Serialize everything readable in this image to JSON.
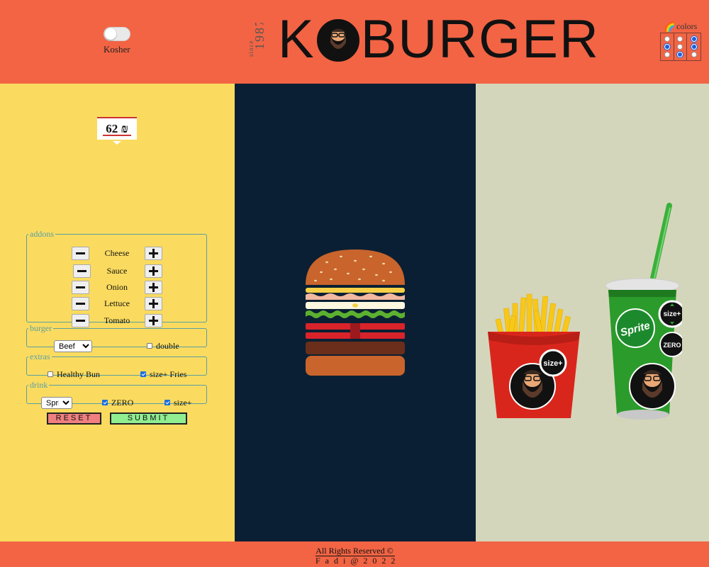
{
  "header": {
    "kosher_label": "Kosher",
    "kosher_on": false,
    "since_label": "since",
    "year": "1987",
    "brand_first": "K",
    "brand_rest": "BURGER",
    "colors_label": "colors",
    "colors_icon": "rainbow-icon",
    "colors_grid_selected": [
      [
        false,
        true,
        false
      ],
      [
        false,
        false,
        true
      ],
      [
        false,
        true,
        false
      ]
    ]
  },
  "price": {
    "value": "62 ₪"
  },
  "addons": {
    "legend": "addons",
    "items": [
      {
        "label": "Cheese"
      },
      {
        "label": "Sauce"
      },
      {
        "label": "Onion"
      },
      {
        "label": "Lettuce"
      },
      {
        "label": "Tomato"
      }
    ]
  },
  "burger": {
    "legend": "burger",
    "selected": "Beef",
    "double_label": "double",
    "double_checked": false
  },
  "extras": {
    "legend": "extras",
    "healthy_bun_label": "Healthy Bun",
    "healthy_bun_checked": false,
    "size_fries_label": "size+ Fries",
    "size_fries_checked": true
  },
  "drink": {
    "legend": "drink",
    "selected": "Sprite",
    "zero_label": "ZERO",
    "zero_checked": true,
    "size_label": "size+",
    "size_checked": true
  },
  "buttons": {
    "reset": "RESET",
    "submit": "SUBMIT"
  },
  "fries_badge": "size+",
  "drink_badges": {
    "brand": "Sprite",
    "size": "size+",
    "zero": "ZERO"
  },
  "footer": {
    "line1": "All Rights Reserved ©",
    "line2": "Fadi@2022"
  },
  "colors": {
    "header_bg": "#f26444",
    "left_bg": "#fadb5f",
    "mid_bg": "#0a1f33",
    "right_bg": "#d4d6bb",
    "reset_bg": "#f08080",
    "submit_bg": "#90ee90"
  }
}
